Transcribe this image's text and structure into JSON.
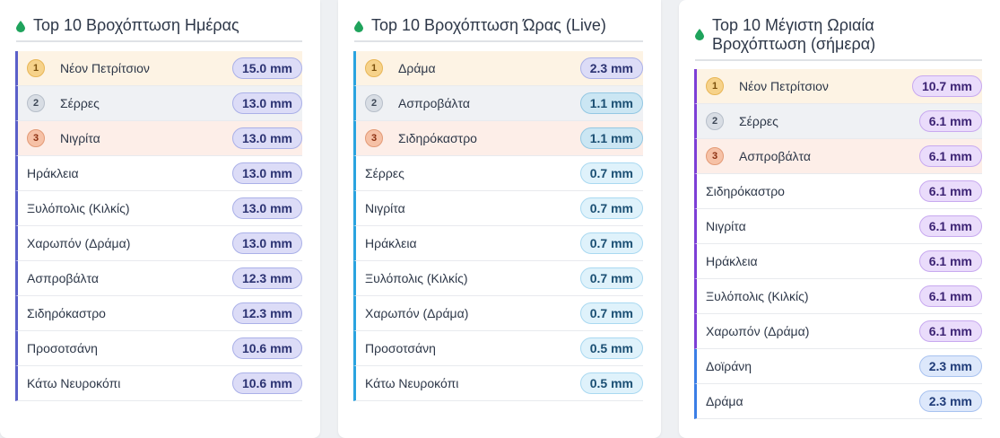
{
  "panels": [
    {
      "title": "Top 10 Βροχόπτωση Ημέρας",
      "rows": [
        {
          "rank": "1",
          "name": "Νέον Πετρίτσιον",
          "value": "15.0 mm"
        },
        {
          "rank": "2",
          "name": "Σέρρες",
          "value": "13.0 mm"
        },
        {
          "rank": "3",
          "name": "Νιγρίτα",
          "value": "13.0 mm"
        },
        {
          "rank": "",
          "name": "Ηράκλεια",
          "value": "13.0 mm"
        },
        {
          "rank": "",
          "name": "Ξυλόπολις (Κιλκίς)",
          "value": "13.0 mm"
        },
        {
          "rank": "",
          "name": "Χαρωπόν (Δράμα)",
          "value": "13.0 mm"
        },
        {
          "rank": "",
          "name": "Ασπροβάλτα",
          "value": "12.3 mm"
        },
        {
          "rank": "",
          "name": "Σιδηρόκαστρο",
          "value": "12.3 mm"
        },
        {
          "rank": "",
          "name": "Προσοτσάνη",
          "value": "10.6 mm"
        },
        {
          "rank": "",
          "name": "Κάτω Νευροκόπι",
          "value": "10.6 mm"
        }
      ]
    },
    {
      "title": "Top 10 Βροχόπτωση Ώρας (Live)",
      "rows": [
        {
          "rank": "1",
          "name": "Δράμα",
          "value": "2.3 mm"
        },
        {
          "rank": "2",
          "name": "Ασπροβάλτα",
          "value": "1.1 mm"
        },
        {
          "rank": "3",
          "name": "Σιδηρόκαστρο",
          "value": "1.1 mm"
        },
        {
          "rank": "",
          "name": "Σέρρες",
          "value": "0.7 mm"
        },
        {
          "rank": "",
          "name": "Νιγρίτα",
          "value": "0.7 mm"
        },
        {
          "rank": "",
          "name": "Ηράκλεια",
          "value": "0.7 mm"
        },
        {
          "rank": "",
          "name": "Ξυλόπολις (Κιλκίς)",
          "value": "0.7 mm"
        },
        {
          "rank": "",
          "name": "Χαρωπόν (Δράμα)",
          "value": "0.7 mm"
        },
        {
          "rank": "",
          "name": "Προσοτσάνη",
          "value": "0.5 mm"
        },
        {
          "rank": "",
          "name": "Κάτω Νευροκόπι",
          "value": "0.5 mm"
        }
      ]
    },
    {
      "title_line1": "Top 10 Μέγιστη Ωριαία",
      "title_line2": "Βροχόπτωση (σήμερα)",
      "rows": [
        {
          "rank": "1",
          "name": "Νέον Πετρίτσιον",
          "value": "10.7 mm"
        },
        {
          "rank": "2",
          "name": "Σέρρες",
          "value": "6.1 mm"
        },
        {
          "rank": "3",
          "name": "Ασπροβάλτα",
          "value": "6.1 mm"
        },
        {
          "rank": "",
          "name": "Σιδηρόκαστρο",
          "value": "6.1 mm"
        },
        {
          "rank": "",
          "name": "Νιγρίτα",
          "value": "6.1 mm"
        },
        {
          "rank": "",
          "name": "Ηράκλεια",
          "value": "6.1 mm"
        },
        {
          "rank": "",
          "name": "Ξυλόπολις (Κιλκίς)",
          "value": "6.1 mm"
        },
        {
          "rank": "",
          "name": "Χαρωπόν (Δράμα)",
          "value": "6.1 mm"
        },
        {
          "rank": "",
          "name": "Δοϊράνη",
          "value": "2.3 mm"
        },
        {
          "rank": "",
          "name": "Δράμα",
          "value": "2.3 mm"
        }
      ]
    }
  ],
  "colors": {
    "drop": "#1fa35c",
    "accent_indigo": "#5a5fc9",
    "accent_cyan": "#2aa3df",
    "accent_purple": "#7d3fd6",
    "accent_blue": "#3a7ee6"
  },
  "icons": {
    "title": "water-drop-icon"
  }
}
